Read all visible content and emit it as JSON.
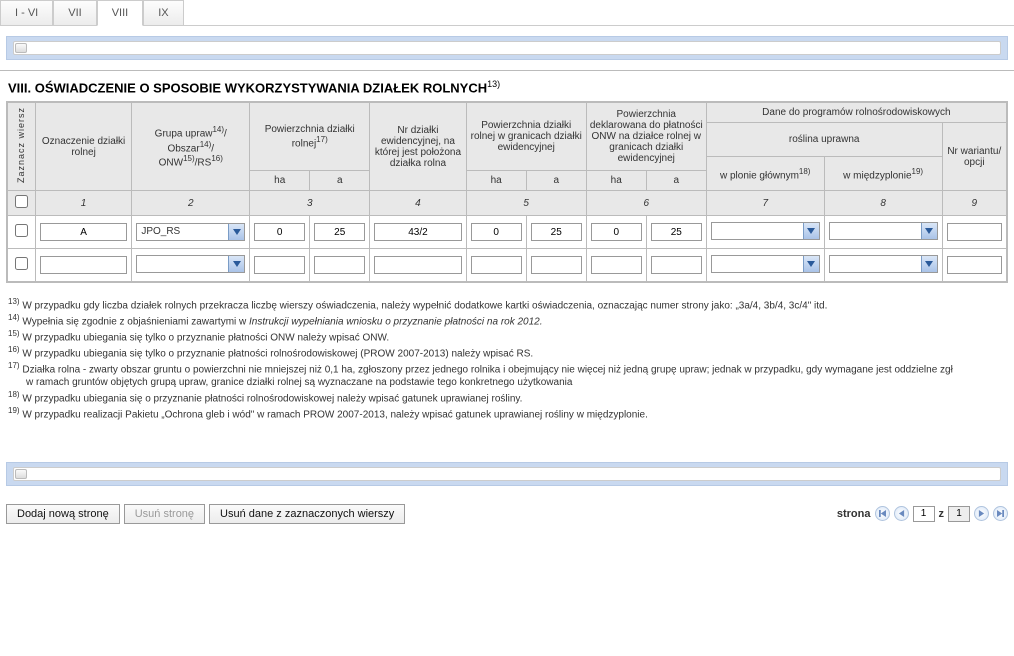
{
  "tabs": {
    "items": [
      "I - VI",
      "VII",
      "VIII",
      "IX"
    ],
    "active": 2
  },
  "section_title": "VIII. OŚWIADCZENIE O SPOSOBIE WYKORZYSTYWANIA DZIAŁEK ROLNYCH",
  "section_title_sup": "13)",
  "headers": {
    "zaznacz": "Zaznacz wiersz",
    "oznaczenie": "Oznaczenie działki rolnej",
    "grupa": "Grupa upraw",
    "grupa_sup1": "14)",
    "grupa_line2a": "Obszar",
    "grupa_sup2": "14)",
    "grupa_line3a": "ONW",
    "grupa_sup3": "15)",
    "grupa_line3b": "/RS",
    "grupa_sup4": "16)",
    "pow_rolnej": "Powierzchnia działki rolnej",
    "pow_rolnej_sup": "17)",
    "nr_dzialki": "Nr działki ewidencyjnej, na której jest położona działka rolna",
    "pow_w_granicach": "Powierzchnia działki rolnej w granicach działki ewidencyjnej",
    "pow_onw": "Powierzchnia deklarowana do płatności ONW na działce rolnej w granicach działki ewidencyjnej",
    "dane_prog": "Dane do programów rolnośrodowiskowych",
    "roslina": "roślina uprawna",
    "w_plonie": "w plonie głównym",
    "w_plonie_sup": "18)",
    "w_miedzy": "w międzyplonie",
    "w_miedzy_sup": "19)",
    "nr_war": "Nr wariantu/ opcji",
    "ha": "ha",
    "a": "a"
  },
  "col_numbers": [
    "1",
    "2",
    "3",
    "4",
    "5",
    "6",
    "7",
    "8",
    "9"
  ],
  "rows": [
    {
      "oznaczenie": "A",
      "grupa": "JPO_RS",
      "pow_ha": "0",
      "pow_a": "25",
      "nr_dzialki": "43/2",
      "gran_ha": "0",
      "gran_a": "25",
      "onw_ha": "0",
      "onw_a": "25",
      "plon_glowny": "",
      "miedzyplon": "",
      "wariant": ""
    },
    {
      "oznaczenie": "",
      "grupa": "",
      "pow_ha": "",
      "pow_a": "",
      "nr_dzialki": "",
      "gran_ha": "",
      "gran_a": "",
      "onw_ha": "",
      "onw_a": "",
      "plon_glowny": "",
      "miedzyplon": "",
      "wariant": ""
    }
  ],
  "footnotes": {
    "f13": "W przypadku gdy liczba działek rolnych przekracza liczbę wierszy oświadczenia, należy wypełnić dodatkowe kartki oświadczenia, oznaczając numer strony jako: „3a/4, 3b/4, 3c/4\" itd.",
    "f14_pre": "Wypełnia się zgodnie z objaśnieniami zawartymi w ",
    "f14_em": "Instrukcji wypełniania wniosku o przyznanie płatności na rok 2012.",
    "f15": "W przypadku ubiegania się tylko o przyznanie płatności ONW należy wpisać ONW.",
    "f16": "W przypadku ubiegania się tylko o przyznanie płatności rolnośrodowiskowej (PROW 2007-2013) należy wpisać RS.",
    "f17a": "Działka rolna - zwarty obszar gruntu o powierzchni nie mniejszej niż 0,1 ha, zgłoszony przez jednego rolnika i obejmujący nie więcej niż jedną grupę upraw; jednak w przypadku, gdy wymagane jest oddzielne zgł",
    "f17b": "w ramach gruntów objętych grupą upraw, granice działki rolnej są wyznaczane na podstawie tego konkretnego użytkowania",
    "f18": "W przypadku ubiegania się o przyznanie płatności rolnośrodowiskowej należy wpisać gatunek uprawianej rośliny.",
    "f19": "W przypadku realizacji Pakietu „Ochrona gleb i wód\" w ramach PROW 2007-2013, należy wpisać gatunek uprawianej rośliny w międzyplonie."
  },
  "actions": {
    "add_page": "Dodaj nową stronę",
    "del_page": "Usuń stronę",
    "del_rows": "Usuń dane z zaznaczonych wierszy"
  },
  "pager": {
    "label": "strona",
    "sep": "z",
    "current": "1",
    "total": "1"
  }
}
